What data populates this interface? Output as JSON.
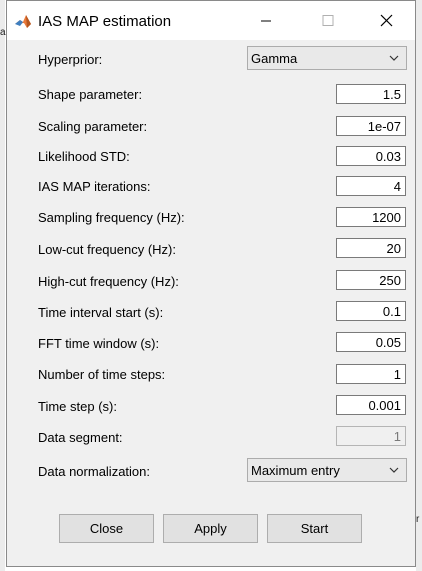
{
  "window": {
    "title": "IAS MAP estimation"
  },
  "background": {
    "left_mark": "a",
    "right_mark": "r"
  },
  "form": {
    "hyperprior": {
      "label": "Hyperprior:",
      "value": "Gamma"
    },
    "shape": {
      "label": "Shape parameter:",
      "value": "1.5"
    },
    "scaling": {
      "label": "Scaling parameter:",
      "value": "1e-07"
    },
    "likelihood_std": {
      "label": "Likelihood STD:",
      "value": "0.03"
    },
    "iterations": {
      "label": "IAS MAP iterations:",
      "value": "4"
    },
    "sampling_freq": {
      "label": "Sampling frequency (Hz):",
      "value": "1200"
    },
    "lowcut": {
      "label": "Low-cut frequency (Hz):",
      "value": "20"
    },
    "highcut": {
      "label": "High-cut frequency (Hz):",
      "value": "250"
    },
    "interval_start": {
      "label": "Time interval start (s):",
      "value": "0.1"
    },
    "fft_window": {
      "label": "FFT time window (s):",
      "value": "0.05"
    },
    "num_steps": {
      "label": "Number of time steps:",
      "value": "1"
    },
    "time_step": {
      "label": "Time step (s):",
      "value": "0.001"
    },
    "data_segment": {
      "label": "Data segment:",
      "value": "1"
    },
    "normalization": {
      "label": "Data normalization:",
      "value": "Maximum entry"
    }
  },
  "buttons": {
    "close": "Close",
    "apply": "Apply",
    "start": "Start"
  }
}
